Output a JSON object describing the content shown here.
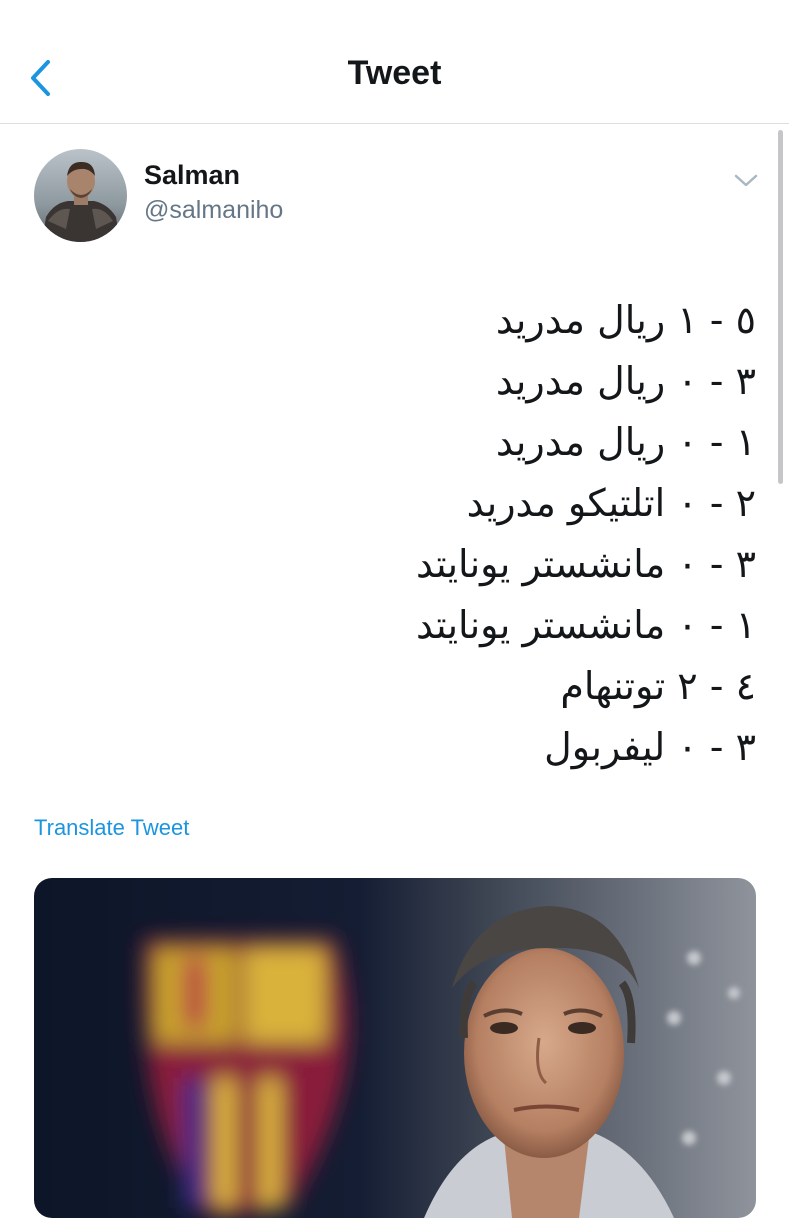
{
  "header": {
    "title": "Tweet"
  },
  "tweet": {
    "author": {
      "display_name": "Salman",
      "handle": "@salmaniho"
    },
    "lines": [
      "٥ - ١ ريال مدريد",
      "٣ - ٠ ريال مدريد",
      "١ - ٠ ريال مدريد",
      "٢ - ٠ اتلتيكو مدريد",
      "٣ - ٠ مانشستر يونايتد",
      "١ - ٠ مانشستر يونايتد",
      "٤ - ٢ توتنهام",
      "٣ - ٠ ليفربول"
    ],
    "translate_label": "Translate Tweet"
  },
  "colors": {
    "accent": "#1b95e0",
    "text_primary": "#14171a",
    "text_secondary": "#657786",
    "divider": "#dcdfe3"
  },
  "icons": {
    "back": "chevron-left-icon",
    "more": "chevron-down-icon"
  }
}
